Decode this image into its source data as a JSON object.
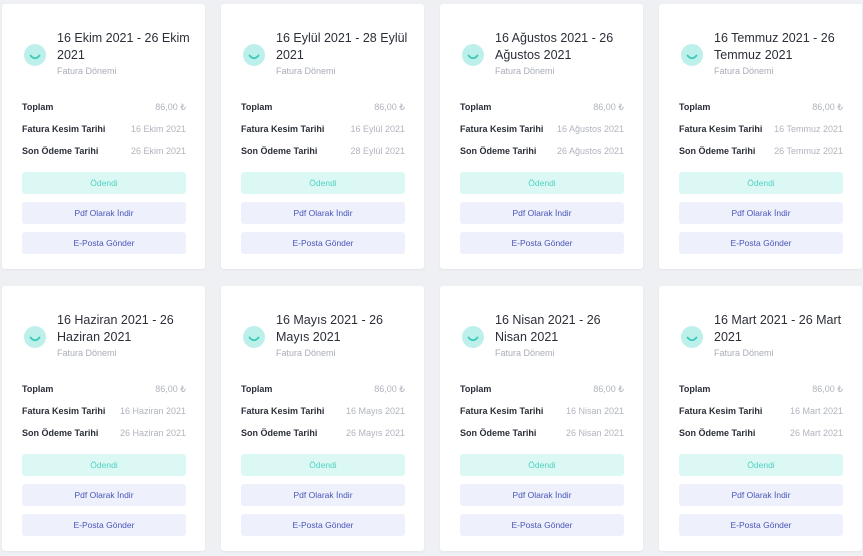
{
  "labels": {
    "period_subtitle": "Fatura Dönemi",
    "total": "Toplam",
    "issue_date": "Fatura Kesim Tarihi",
    "due_date": "Son Ödeme Tarihi",
    "paid": "Ödendi",
    "download_pdf": "Pdf Olarak İndir",
    "send_email": "E-Posta Gönder"
  },
  "colors": {
    "accent_teal": "#4fd2c2",
    "accent_blue": "#4856b8"
  },
  "invoices": [
    {
      "period": "16 Ekim 2021 - 26 Ekim 2021",
      "total": "86,00 ₺",
      "issue_date": "16 Ekim 2021",
      "due_date": "26 Ekim 2021",
      "status": "paid"
    },
    {
      "period": "16 Eylül 2021 - 28 Eylül 2021",
      "total": "86,00 ₺",
      "issue_date": "16 Eylül 2021",
      "due_date": "28 Eylül 2021",
      "status": "paid"
    },
    {
      "period": "16 Ağustos 2021 - 26 Ağustos 2021",
      "total": "86,00 ₺",
      "issue_date": "16 Ağustos 2021",
      "due_date": "26 Ağustos 2021",
      "status": "paid"
    },
    {
      "period": "16 Temmuz 2021 - 26 Temmuz 2021",
      "total": "86,00 ₺",
      "issue_date": "16 Temmuz 2021",
      "due_date": "26 Temmuz 2021",
      "status": "paid"
    },
    {
      "period": "16 Haziran 2021 - 26 Haziran 2021",
      "total": "86,00 ₺",
      "issue_date": "16 Haziran 2021",
      "due_date": "26 Haziran 2021",
      "status": "paid"
    },
    {
      "period": "16 Mayıs 2021 - 26 Mayıs 2021",
      "total": "86,00 ₺",
      "issue_date": "16 Mayıs 2021",
      "due_date": "26 Mayıs 2021",
      "status": "paid"
    },
    {
      "period": "16 Nisan 2021 - 26 Nisan 2021",
      "total": "86,00 ₺",
      "issue_date": "16 Nisan 2021",
      "due_date": "26 Nisan 2021",
      "status": "paid"
    },
    {
      "period": "16 Mart 2021 - 26 Mart 2021",
      "total": "86,00 ₺",
      "issue_date": "16 Mart 2021",
      "due_date": "26 Mart 2021",
      "status": "paid"
    }
  ]
}
